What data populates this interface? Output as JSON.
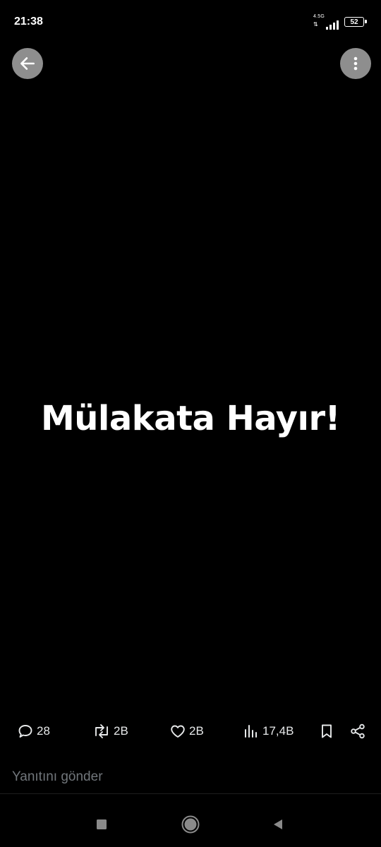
{
  "status_bar": {
    "time": "21:38",
    "network": "4.5G",
    "battery_level": "52"
  },
  "post": {
    "headline": "Mülakata Hayır!"
  },
  "actions": {
    "replies": "28",
    "reposts": "2B",
    "likes": "2B",
    "views": "17,4B"
  },
  "reply": {
    "placeholder": "Yanıtını gönder"
  },
  "icons": {
    "back": "arrow-left-icon",
    "more": "more-vertical-icon",
    "reply": "speech-bubble-icon",
    "repost": "repost-icon",
    "like": "heart-icon",
    "views": "bar-chart-icon",
    "bookmark": "bookmark-icon",
    "share": "share-icon"
  },
  "colors": {
    "background": "#000000",
    "text": "#ffffff",
    "muted": "#71767b",
    "icon_button_bg": "#8e8e8e"
  }
}
